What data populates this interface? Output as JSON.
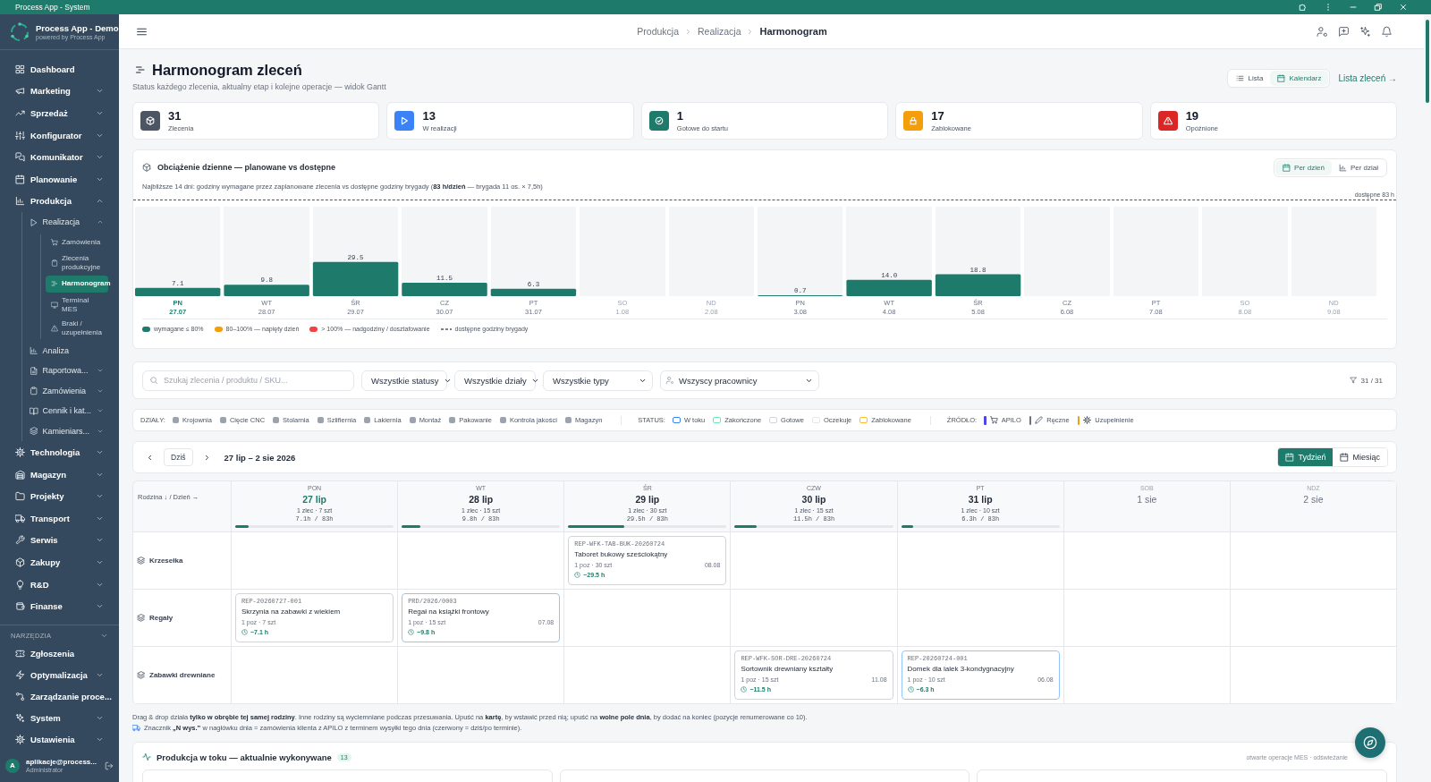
{
  "window": {
    "title": "Process App - System"
  },
  "sidebar": {
    "app_name": "Process App - Demo",
    "app_subtitle": "powered by Process App",
    "items": [
      {
        "label": "Dashboard",
        "kind": "dashboard",
        "selected": false
      },
      {
        "label": "Marketing",
        "kind": "marketing",
        "selected": false,
        "expanded": false
      },
      {
        "label": "Sprzedaż",
        "kind": "sales",
        "selected": false,
        "expanded": false
      },
      {
        "label": "Konfigurator",
        "kind": "configurator",
        "selected": false,
        "expanded": false
      },
      {
        "label": "Komunikator",
        "kind": "messenger",
        "selected": false,
        "expanded": false
      },
      {
        "label": "Planowanie",
        "kind": "planning",
        "selected": false,
        "expanded": false
      },
      {
        "label": "Produkcja",
        "kind": "production",
        "selected": false,
        "expanded": true,
        "children": [
          {
            "label": "Realizacja",
            "kind": "execution",
            "selected": false,
            "expanded": true,
            "children": [
              {
                "label": "Zamówienia",
                "kind": "customer_orders",
                "selected": false
              },
              {
                "label": "Zlecenia produkcyjne",
                "kind": "production_orders",
                "selected": false
              },
              {
                "label": "Harmonogram",
                "kind": "schedule",
                "selected": true
              },
              {
                "label": "Terminal MES",
                "kind": "terminal",
                "selected": false
              },
              {
                "label": "Braki / uzupełnienia",
                "kind": "shortages",
                "selected": false
              }
            ]
          },
          {
            "label": "Analiza",
            "kind": "analysis",
            "selected": false
          },
          {
            "label": "Raportowa...",
            "kind": "reports",
            "selected": false,
            "expanded": false
          },
          {
            "label": "Zamówienia",
            "kind": "orders",
            "selected": false,
            "expanded": false
          },
          {
            "label": "Cennik i kat...",
            "kind": "pricelist",
            "selected": false,
            "expanded": false
          },
          {
            "label": "Kamieniars...",
            "kind": "stonework",
            "selected": false,
            "expanded": false
          }
        ]
      },
      {
        "label": "Technologia",
        "kind": "technology",
        "selected": false,
        "expanded": false
      },
      {
        "label": "Magazyn",
        "kind": "warehouse",
        "selected": false,
        "expanded": false
      },
      {
        "label": "Projekty",
        "kind": "projects",
        "selected": false,
        "expanded": false
      },
      {
        "label": "Transport",
        "kind": "transport",
        "selected": false,
        "expanded": false
      },
      {
        "label": "Serwis",
        "kind": "service",
        "selected": false,
        "expanded": false
      },
      {
        "label": "Zakupy",
        "kind": "purchasing",
        "selected": false,
        "expanded": false
      },
      {
        "label": "R&D",
        "kind": "rnd",
        "selected": false,
        "expanded": false
      },
      {
        "label": "Finanse",
        "kind": "finance",
        "selected": false,
        "expanded": false
      }
    ],
    "tools_section": {
      "label": "NARZĘDZIA",
      "items": [
        {
          "label": "Zgłoszenia",
          "kind": "tickets",
          "selected": false
        },
        {
          "label": "Optymalizacja",
          "kind": "optimization",
          "selected": false,
          "expanded": false
        },
        {
          "label": "Zarządzanie proce...",
          "kind": "processes",
          "selected": false,
          "expanded": false
        },
        {
          "label": "System",
          "kind": "system",
          "selected": false,
          "expanded": false
        },
        {
          "label": "Ustawienia",
          "kind": "settings",
          "selected": false,
          "expanded": false
        }
      ]
    },
    "user": {
      "initial": "A",
      "name": "aplikacje@process...",
      "role": "Administrator"
    }
  },
  "header": {
    "breadcrumb": [
      {
        "label": "Produkcja",
        "current": false
      },
      {
        "label": "Realizacja",
        "current": false
      },
      {
        "label": "Harmonogram",
        "current": true
      }
    ]
  },
  "page": {
    "title": "Harmonogram zleceń",
    "subtitle": "Status każdego zlecenia, aktualny etap i kolejne operacje — widok Gantt",
    "view_toggle": [
      {
        "label": "Lista",
        "kind": "list",
        "selected": false
      },
      {
        "label": "Kalendarz",
        "kind": "calendar",
        "selected": true
      }
    ],
    "link": "Lista zleceń →"
  },
  "stats": [
    {
      "value": "31",
      "label": "Zlecenia",
      "kind": "total",
      "color": "#4b5563"
    },
    {
      "value": "13",
      "label": "W realizacji",
      "kind": "in_progress",
      "color": "#3b82f6"
    },
    {
      "value": "1",
      "label": "Gotowe do startu",
      "kind": "ready",
      "color": "#1e7b6b"
    },
    {
      "value": "17",
      "label": "Zablokowane",
      "kind": "blocked",
      "color": "#f59e0b"
    },
    {
      "value": "19",
      "label": "Opóźnione",
      "kind": "late",
      "color": "#dc2626"
    }
  ],
  "load_chart": {
    "title": "Obciążenie dzienne — planowane vs dostępne",
    "mode_toggle": [
      {
        "label": "Per dzień",
        "kind": "day",
        "selected": true
      },
      {
        "label": "Per dział",
        "kind": "department",
        "selected": false
      }
    ],
    "description": "Najbliższe 14 dni: godziny wymagane przez zaplanowane zlecenia vs dostępne godziny brygady (**83 h/dzień** — brygada 11 os. × 7,5h)",
    "capacity_label": "dostępne 83 h",
    "category_states": [
      {
        "today": true,
        "weekend": false
      },
      {
        "today": false,
        "weekend": false
      },
      {
        "today": false,
        "weekend": false
      },
      {
        "today": false,
        "weekend": false
      },
      {
        "today": false,
        "weekend": false
      },
      {
        "today": false,
        "weekend": true
      },
      {
        "today": false,
        "weekend": true
      },
      {
        "today": false,
        "weekend": false
      },
      {
        "today": false,
        "weekend": false
      },
      {
        "today": false,
        "weekend": false
      },
      {
        "today": false,
        "weekend": false
      },
      {
        "today": false,
        "weekend": false
      },
      {
        "today": false,
        "weekend": true
      },
      {
        "today": false,
        "weekend": true
      }
    ],
    "chart_data": {
      "type": "bar",
      "categories": [
        "PN 27.07",
        "WT 28.07",
        "ŚR 29.07",
        "CZ 30.07",
        "PT 31.07",
        "SO 1.08",
        "ND 2.08",
        "PN 3.08",
        "WT 4.08",
        "ŚR 5.08",
        "CZ 6.08",
        "PT 7.08",
        "SO 8.08",
        "ND 9.08"
      ],
      "values": [
        7.1,
        9.8,
        29.5,
        11.5,
        6.3,
        0,
        0,
        0.7,
        14.0,
        18.8,
        0,
        0,
        0,
        0
      ],
      "value_labels": [
        "7.1",
        "9.8",
        "29.5",
        "11.5",
        "6.3",
        null,
        null,
        "0.7",
        "14.0",
        "18.8",
        null,
        null,
        null,
        null
      ]
    },
    "legend": [
      {
        "label": "wymagane ≤ 80%",
        "kind": "dot",
        "color": "#1e7b6b"
      },
      {
        "label": "80–100% — napięty dzień",
        "kind": "dot",
        "color": "#f59e0b"
      },
      {
        "label": "> 100% — nadgodziny / dosztafowanie",
        "kind": "dot",
        "color": "#ef4444"
      },
      {
        "label": "dostępne godziny brygady",
        "kind": "dash"
      }
    ]
  },
  "filters": {
    "search": {
      "placeholder": "Szukaj zlecenia / produktu / SKU..."
    },
    "selects": [
      {
        "value": "Wszystkie statusy",
        "kind": "plain"
      },
      {
        "value": "Wszystkie działy",
        "kind": "plain"
      },
      {
        "value": "Wszystkie typy",
        "kind": "plain"
      },
      {
        "value": "Wszyscy pracownicy",
        "kind": "person"
      }
    ],
    "count": "31 / 31"
  },
  "legend_bar": {
    "groups": [
      {
        "label": "DZIAŁY:",
        "kind": "departments",
        "items": [
          {
            "label": "Krojownia"
          },
          {
            "label": "Cięcie CNC"
          },
          {
            "label": "Stolarnia"
          },
          {
            "label": "Szlifiernia"
          },
          {
            "label": "Lakiernia"
          },
          {
            "label": "Montaż"
          },
          {
            "label": "Pakowanie"
          },
          {
            "label": "Kontrola jakości"
          },
          {
            "label": "Magazyn"
          }
        ]
      },
      {
        "label": "STATUS:",
        "kind": "statuses",
        "items": [
          {
            "label": "W toku",
            "color": "#3b82f6"
          },
          {
            "label": "Zakończone",
            "color": "#6ee7b7"
          },
          {
            "label": "Gotowe",
            "color": "#d1d5db"
          },
          {
            "label": "Oczekuje",
            "color": "#e5e7eb"
          },
          {
            "label": "Zablokowane",
            "color": "#fbbf24"
          }
        ]
      },
      {
        "label": "ŹRÓDŁO:",
        "kind": "sources",
        "items": [
          {
            "label": "APILO",
            "kind": "apilo",
            "color": "#4f46e5"
          },
          {
            "label": "Ręczne",
            "kind": "manual",
            "color": "#6b7280"
          },
          {
            "label": "Uzupełnienie",
            "kind": "replenishment",
            "color": "#f59e0b"
          }
        ]
      }
    ]
  },
  "calendar": {
    "today_button": "Dziś",
    "range": "27 lip – 2 sie 2026",
    "view_toggle": [
      {
        "label": "Tydzień",
        "selected": true
      },
      {
        "label": "Miesiąc",
        "selected": false
      }
    ],
    "corner": "Rodzina ↓ / Dzień →",
    "days": [
      {
        "weekday": "PON",
        "date": "27 lip",
        "today": true,
        "weekend": false,
        "summary": "1 zlec · 7 szt",
        "hours": "7.1h / 83h",
        "level": 0.086
      },
      {
        "weekday": "WT",
        "date": "28 lip",
        "today": false,
        "weekend": false,
        "summary": "1 zlec · 15 szt",
        "hours": "9.8h / 83h",
        "level": 0.118
      },
      {
        "weekday": "ŚR",
        "date": "29 lip",
        "today": false,
        "weekend": false,
        "summary": "1 zlec · 30 szt",
        "hours": "29.5h / 83h",
        "level": 0.355
      },
      {
        "weekday": "CZW",
        "date": "30 lip",
        "today": false,
        "weekend": false,
        "summary": "1 zlec · 15 szt",
        "hours": "11.5h / 83h",
        "level": 0.139
      },
      {
        "weekday": "PT",
        "date": "31 lip",
        "today": false,
        "weekend": false,
        "summary": "1 zlec · 10 szt",
        "hours": "6.3h / 83h",
        "level": 0.076
      },
      {
        "weekday": "SOB",
        "date": "1 sie",
        "today": false,
        "weekend": true
      },
      {
        "weekday": "NDZ",
        "date": "2 sie",
        "today": false,
        "weekend": true
      }
    ],
    "rows": [
      {
        "family": "Krzesełka",
        "cells": [
          {
            "kind": "empty"
          },
          {
            "kind": "empty"
          },
          {
            "kind": "order",
            "number": "REP-WFK-TAB-BUK-20260724",
            "title": "Taboret bukowy sześciokątny",
            "quantity": "1 poz · 30 szt",
            "due": "08.08",
            "hours": "~29.5 h",
            "color": "#d1d5db"
          },
          {
            "kind": "empty"
          },
          {
            "kind": "empty"
          },
          {
            "kind": "empty"
          },
          {
            "kind": "empty"
          }
        ]
      },
      {
        "family": "Regały",
        "cells": [
          {
            "kind": "order",
            "number": "REP-20260727-001",
            "title": "Skrzynia na zabawki z wiekiem",
            "quantity": "1 poz · 7 szt",
            "hours": "~7.1 h",
            "color": "#d1d5db"
          },
          {
            "kind": "order",
            "number": "PRD/2026/0003",
            "title": "Regał na książki frontowy",
            "quantity": "1 poz · 15 szt",
            "due": "07.08",
            "hours": "~9.8 h",
            "color": "#93c5fd"
          },
          {
            "kind": "empty"
          },
          {
            "kind": "empty"
          },
          {
            "kind": "empty"
          },
          {
            "kind": "empty"
          },
          {
            "kind": "empty"
          }
        ]
      },
      {
        "family": "Zabawki drewniane",
        "cells": [
          {
            "kind": "empty"
          },
          {
            "kind": "empty"
          },
          {
            "kind": "empty"
          },
          {
            "kind": "order",
            "number": "REP-WFK-SOR-DRE-20260724",
            "title": "Sortownik drewniany kształty",
            "quantity": "1 poz · 15 szt",
            "due": "11.08",
            "hours": "~11.5 h",
            "color": "#d1d5db"
          },
          {
            "kind": "order",
            "number": "REP-20260724-001",
            "title": "Domek dla lalek 3-kondygnacyjny",
            "quantity": "1 poz · 10 szt",
            "due": "06.08",
            "hours": "~6.3 h",
            "color": "#93c5fd"
          },
          {
            "kind": "empty"
          },
          {
            "kind": "empty"
          }
        ]
      }
    ]
  },
  "notes": [
    {
      "kind": "plain",
      "text": "Drag & drop działa **tylko w obrębie tej samej rodziny**. Inne rodziny są wyciemniane podczas przesuwania. Upuść na **kartę**, by wstawić przed nią; upuść na **wolne pole dnia**, by dodać na koniec (pozycje renumerowane co 10)."
    },
    {
      "kind": "shipping",
      "text": "Znacznik **„N wys.”** w nagłówku dnia = zamówienia klienta z APILO z terminem wysyłki tego dnia (czerwony = dziś/po terminie)."
    }
  ],
  "in_progress": {
    "title": "Produkcja w toku — aktualnie wykonywane",
    "count": "13",
    "meta": "otwarte operacje MES · odświeżanie"
  }
}
